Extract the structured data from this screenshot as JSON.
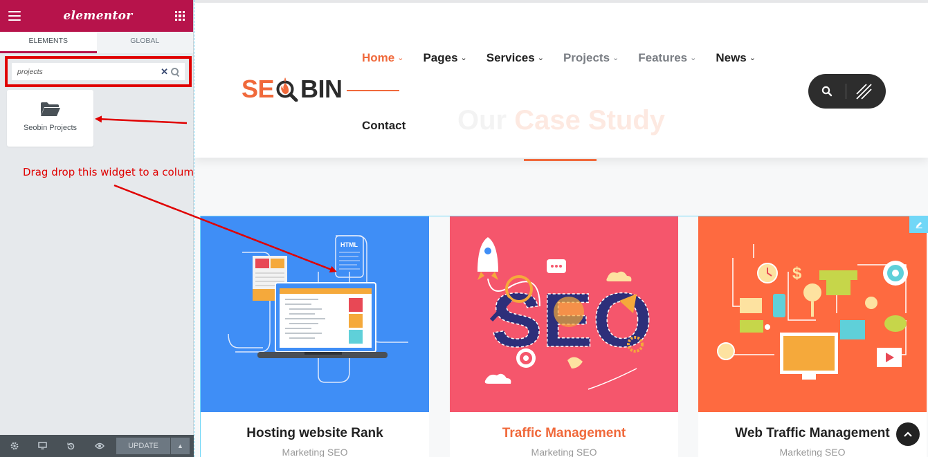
{
  "sidebar": {
    "brand": "elementor",
    "tabs": [
      "ELEMENTS",
      "GLOBAL"
    ],
    "search_value": "projects",
    "widget_label": "Seobin Projects",
    "annotation": "Drag  drop this widget to a column",
    "footer": {
      "update_label": "UPDATE"
    }
  },
  "header": {
    "logo": {
      "part1": "SE",
      "part2": "BIN"
    },
    "nav": [
      {
        "label": "Home",
        "state": "active"
      },
      {
        "label": "Pages",
        "state": "normal"
      },
      {
        "label": "Services",
        "state": "normal"
      },
      {
        "label": "Projects",
        "state": "muted"
      },
      {
        "label": "Features",
        "state": "muted"
      },
      {
        "label": "News",
        "state": "normal"
      }
    ],
    "nav_second_row": "Contact",
    "chevron": "⌄"
  },
  "section": {
    "title_part1": "Our ",
    "title_part2": "Case Study"
  },
  "cards": [
    {
      "title": "Hosting website Rank",
      "sub": "Marketing SEO",
      "bg": "#3f8ef6"
    },
    {
      "title": "Traffic Management",
      "sub": "Marketing SEO",
      "bg": "#f5566c"
    },
    {
      "title": "Web Traffic Management",
      "sub": "Marketing SEO",
      "bg": "#fe6a40"
    }
  ],
  "colors": {
    "elementor": "#b7134b",
    "accent": "#f0693b",
    "annotation": "#e00000"
  }
}
